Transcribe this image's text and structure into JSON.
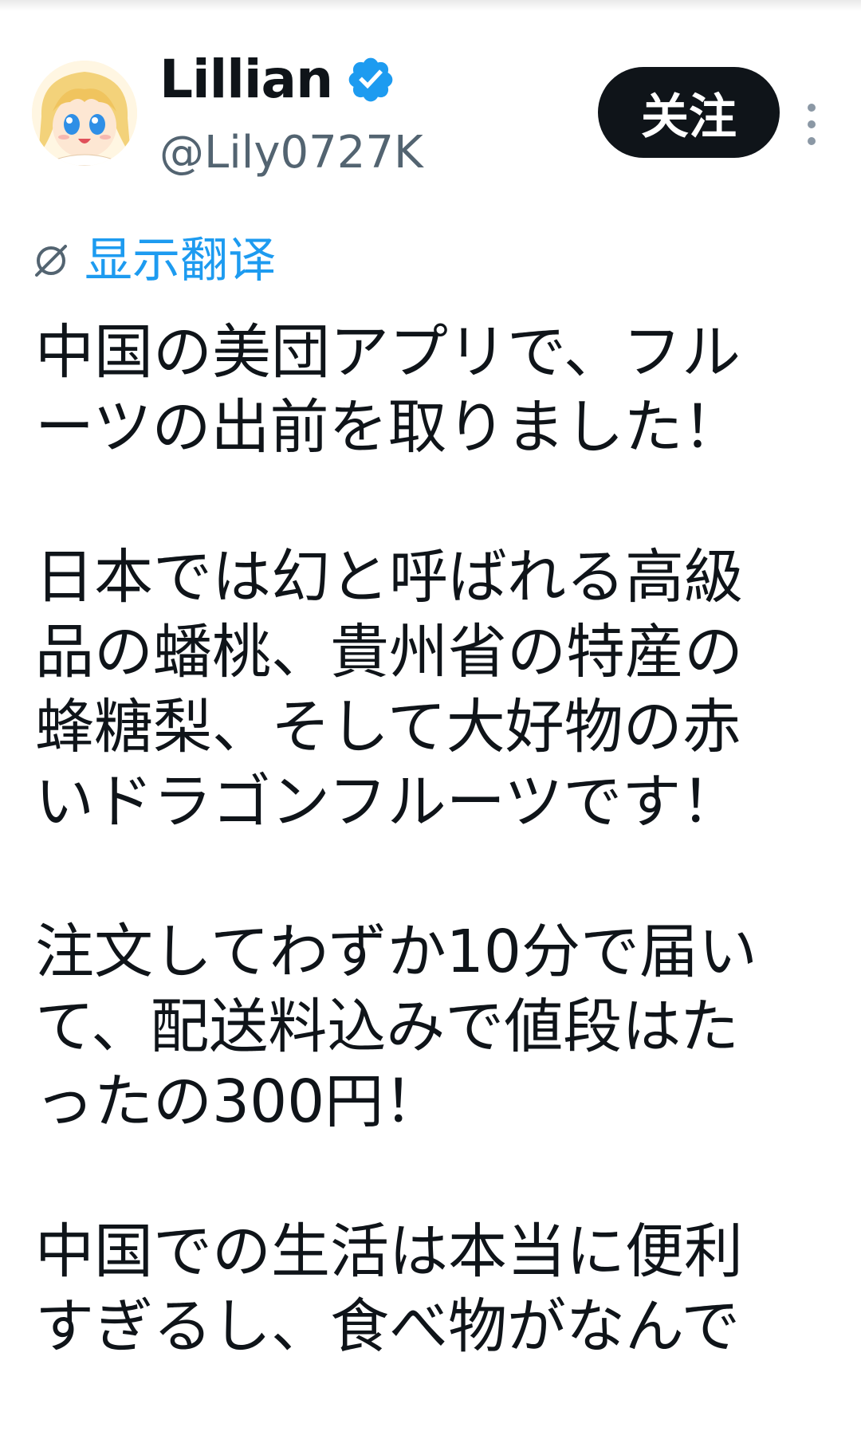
{
  "author": {
    "display_name": "Lillian",
    "handle": "@Lily0727K",
    "verified": true
  },
  "actions": {
    "follow_label": "关注"
  },
  "translate": {
    "label": "显示翻译",
    "icon": "globe-slash-icon"
  },
  "tweet": {
    "paragraphs": [
      [
        "中国の美団アプリで、フル",
        "ーツの出前を取りました！"
      ],
      [
        "日本では幻と呼ばれる高級",
        "品の蟠桃、貴州省の特産の",
        "蜂糖梨、そして大好物の赤",
        "いドラゴンフルーツです！"
      ],
      [
        "注文してわずか10分で届い",
        "て、配送料込みで値段はた",
        "ったの300円！"
      ],
      [
        "中国での生活は本当に便利",
        "すぎるし、食べ物がなんで"
      ]
    ]
  },
  "colors": {
    "text": "#0f1419",
    "handle": "#536471",
    "link": "#1d9bf0",
    "verified_badge": "#1d9bf0",
    "button_bg": "#0f1419",
    "button_text": "#ffffff"
  }
}
